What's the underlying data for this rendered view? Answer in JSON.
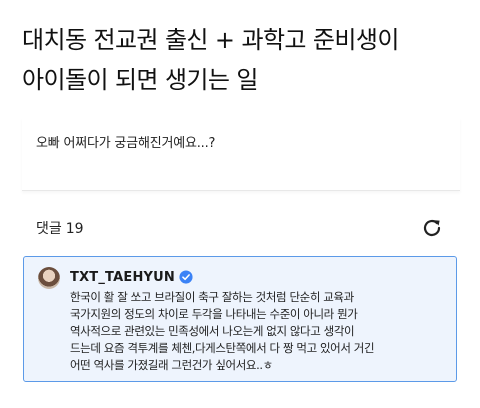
{
  "headline": {
    "line1": "대치동 전교권 출신 + 과학고 준비생이",
    "line2": "아이돌이 되면 생기는 일"
  },
  "question": {
    "text": "오빠 어쩌다가 궁금해진거예요...?"
  },
  "comments": {
    "label": "댓글",
    "count": "19"
  },
  "comment": {
    "username": "TXT_TAEHYUN",
    "lines": [
      "한국이 활 잘 쏘고 브라질이 축구 잘하는 것처럼 단순히 교육과",
      "국가지원의 정도의 차이로 두각을 나타내는 수준이 아니라 뭔가",
      "역사적으로 관련있는 민족성에서 나오는게 없지 않다고 생각이",
      "드는데 요즘 격투계를 체첸,다게스탄쪽에서 다 짱 먹고 있어서 거긴",
      "어떤 역사를 가졌길래 그런건가 싶어서요..ㅎ"
    ]
  },
  "colors": {
    "accent": "#5c9ae8",
    "comment_bg": "#eef4fd",
    "verified": "#3b82f6"
  },
  "icons": {
    "refresh": "refresh-icon",
    "verified": "verified-badge-icon"
  }
}
